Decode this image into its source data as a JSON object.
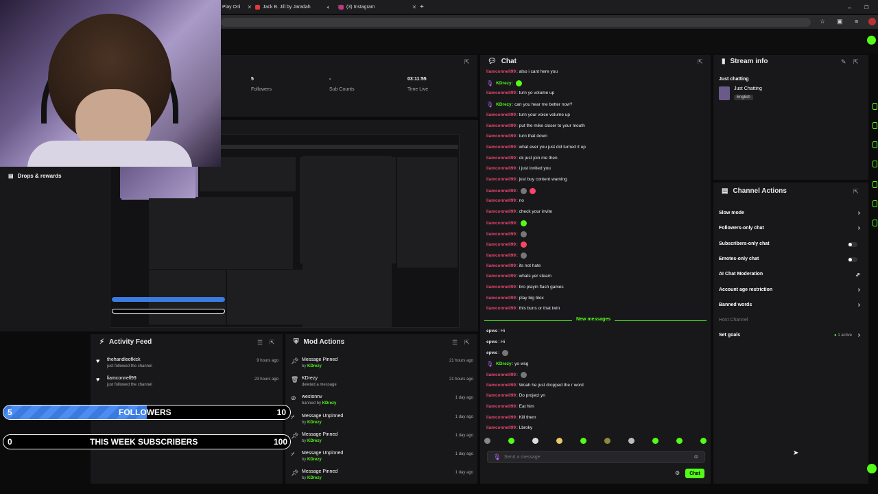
{
  "browser": {
    "tabs": [
      {
        "label": "Play Onl",
        "color": "#3a7be0"
      },
      {
        "label": "Jack B. Jill by Jaradah",
        "color": "#e03a3a"
      },
      {
        "label": "(3) Instagram",
        "color": "#c13584"
      }
    ],
    "new_tab": "+"
  },
  "stats": [
    {
      "value": "5",
      "label": "Followers"
    },
    {
      "value": "-",
      "label": "Sub Counts"
    },
    {
      "value": "03:11:55",
      "label": "Time Live"
    }
  ],
  "drops": {
    "label": "Drops & rewards"
  },
  "activity_feed": {
    "title": "Activity Feed",
    "items": [
      {
        "name": "thehandleofkick",
        "sub": "just followed the channel",
        "time": "9 hours ago"
      },
      {
        "name": "liamconnell99",
        "sub": "just followed the channel",
        "time": "23 hours ago"
      }
    ]
  },
  "mod_actions": {
    "title": "Mod Actions",
    "items": [
      {
        "icon": "pin-icon",
        "title": "Message Pinned",
        "by": "by",
        "who": "KDrezy",
        "time": "21 hours ago"
      },
      {
        "icon": "trash-icon",
        "title": "KDrezy",
        "by": "deleted a message",
        "who": "",
        "time": "21 hours ago"
      },
      {
        "icon": "ban-icon",
        "title": "westonnv",
        "by": "banned by",
        "who": "KDrezy",
        "time": "1 day ago"
      },
      {
        "icon": "unpin-icon",
        "title": "Message Unpinned",
        "by": "by",
        "who": "KDrezy",
        "time": "1 day ago"
      },
      {
        "icon": "pin-icon",
        "title": "Message Pinned",
        "by": "by",
        "who": "KDrezy",
        "time": "1 day ago"
      },
      {
        "icon": "unpin-icon",
        "title": "Message Unpinned",
        "by": "by",
        "who": "KDrezy",
        "time": "1 day ago"
      },
      {
        "icon": "pin-icon",
        "title": "Message Pinned",
        "by": "by",
        "who": "KDrezy",
        "time": "1 day ago"
      }
    ]
  },
  "goals": [
    {
      "start": "5",
      "label": "FOLLOWERS",
      "end": "10",
      "progress": 0.5
    },
    {
      "start": "0",
      "label": "THIS WEEK SUBSCRIBERS",
      "end": "100",
      "progress": 0
    }
  ],
  "chat": {
    "title": "Chat",
    "messages": [
      {
        "user": "liamconnell99",
        "type": "g",
        "text": ": also i cant here you",
        "emotes": []
      },
      {
        "user": "KDrezy",
        "type": "kd",
        "text": ":",
        "emotes": [
          "g"
        ]
      },
      {
        "user": "liamconnell99",
        "type": "g",
        "text": ": turn yo volume up",
        "emotes": []
      },
      {
        "user": "KDrezy",
        "type": "kd",
        "text": ": can you hear me better now?",
        "emotes": []
      },
      {
        "user": "liamconnell99",
        "type": "g",
        "text": ": turn your voice volume up",
        "emotes": []
      },
      {
        "user": "liamconnell99",
        "type": "g",
        "text": ": put the mike closer to your mouth",
        "emotes": []
      },
      {
        "user": "liamconnell99",
        "type": "g",
        "text": ": turn that down",
        "emotes": []
      },
      {
        "user": "liamconnell99",
        "type": "g",
        "text": ": what ever you just did turned it up",
        "emotes": []
      },
      {
        "user": "liamconnell99",
        "type": "g",
        "text": ": ok just join me then",
        "emotes": []
      },
      {
        "user": "liamconnell99",
        "type": "g",
        "text": ": i just invited you",
        "emotes": []
      },
      {
        "user": "liamconnell99",
        "type": "g",
        "text": ": just buy content warning",
        "emotes": []
      },
      {
        "user": "liamconnell99",
        "type": "g",
        "text": ":",
        "emotes": [
          "dark",
          "red"
        ]
      },
      {
        "user": "liamconnell99",
        "type": "g",
        "text": ": no",
        "emotes": []
      },
      {
        "user": "liamconnell99",
        "type": "g",
        "text": ": check your invite",
        "emotes": []
      },
      {
        "user": "liamconnell99",
        "type": "g",
        "text": ":",
        "emotes": [
          "g"
        ]
      },
      {
        "user": "liamconnell99",
        "type": "g",
        "text": ":",
        "emotes": [
          "dark"
        ]
      },
      {
        "user": "liamconnell99",
        "type": "g",
        "text": ":",
        "emotes": [
          "red"
        ]
      },
      {
        "user": "liamconnell99",
        "type": "g",
        "text": ":",
        "emotes": [
          "dark"
        ]
      },
      {
        "user": "liamconnell99",
        "type": "g",
        "text": ": its not hate",
        "emotes": []
      },
      {
        "user": "liamconnell99",
        "type": "g",
        "text": ": whats yer steam",
        "emotes": []
      },
      {
        "user": "liamconnell99",
        "type": "g",
        "text": ": bro playin flash games",
        "emotes": []
      },
      {
        "user": "liamconnell99",
        "type": "g",
        "text": ": play big blox",
        "emotes": []
      },
      {
        "user": "liamconnell99",
        "type": "g",
        "text": ": this buns or that twin",
        "emotes": []
      }
    ],
    "new_messages_label": "New messages",
    "new": [
      {
        "user": "epws",
        "type": "ep",
        "text": ": Hi",
        "emotes": []
      },
      {
        "user": "epws",
        "type": "ep",
        "text": ": Hi",
        "emotes": []
      },
      {
        "user": "epws",
        "type": "ep",
        "text": ":",
        "emotes": [
          "dark"
        ]
      },
      {
        "user": "KDrezy",
        "type": "kd",
        "text": ": yo wsg",
        "emotes": []
      },
      {
        "user": "liamconnell99",
        "type": "g",
        "text": ":",
        "emotes": [
          "dark"
        ]
      },
      {
        "user": "liamconnell99",
        "type": "g",
        "text": ": Woah he just dropped the r word",
        "emotes": []
      },
      {
        "user": "liamconnell99",
        "type": "g",
        "text": ": Do project yn",
        "emotes": []
      },
      {
        "user": "liamconnell99",
        "type": "g",
        "text": ": Eat him",
        "emotes": []
      },
      {
        "user": "liamconnell99",
        "type": "g",
        "text": ": Kill them",
        "emotes": []
      },
      {
        "user": "liamconnell99",
        "type": "g",
        "text": ": Lbroky",
        "emotes": []
      }
    ],
    "input_placeholder": "Send a message",
    "send_label": "Chat"
  },
  "stream_info": {
    "title": "Stream info",
    "stream_title": "Just chatting",
    "category": "Just Chatting",
    "language": "English"
  },
  "channel_actions": {
    "title": "Channel Actions",
    "items": [
      {
        "label": "Slow mode",
        "control": "chevron"
      },
      {
        "label": "Followers-only chat",
        "control": "chevron"
      },
      {
        "label": "Subscribers-only chat",
        "control": "toggle"
      },
      {
        "label": "Emotes-only chat",
        "control": "toggle"
      },
      {
        "label": "AI Chat Moderation",
        "control": "external"
      },
      {
        "label": "Account age restriction",
        "control": "chevron"
      },
      {
        "label": "Banned words",
        "control": "chevron"
      },
      {
        "label": "Host Channel",
        "control": "none"
      },
      {
        "label": "Set goals",
        "control": "chevron",
        "badge": "1 active"
      }
    ]
  },
  "colors": {
    "accent": "#53fc18",
    "panel": "#18181b",
    "chat_user": "#e8466c"
  }
}
